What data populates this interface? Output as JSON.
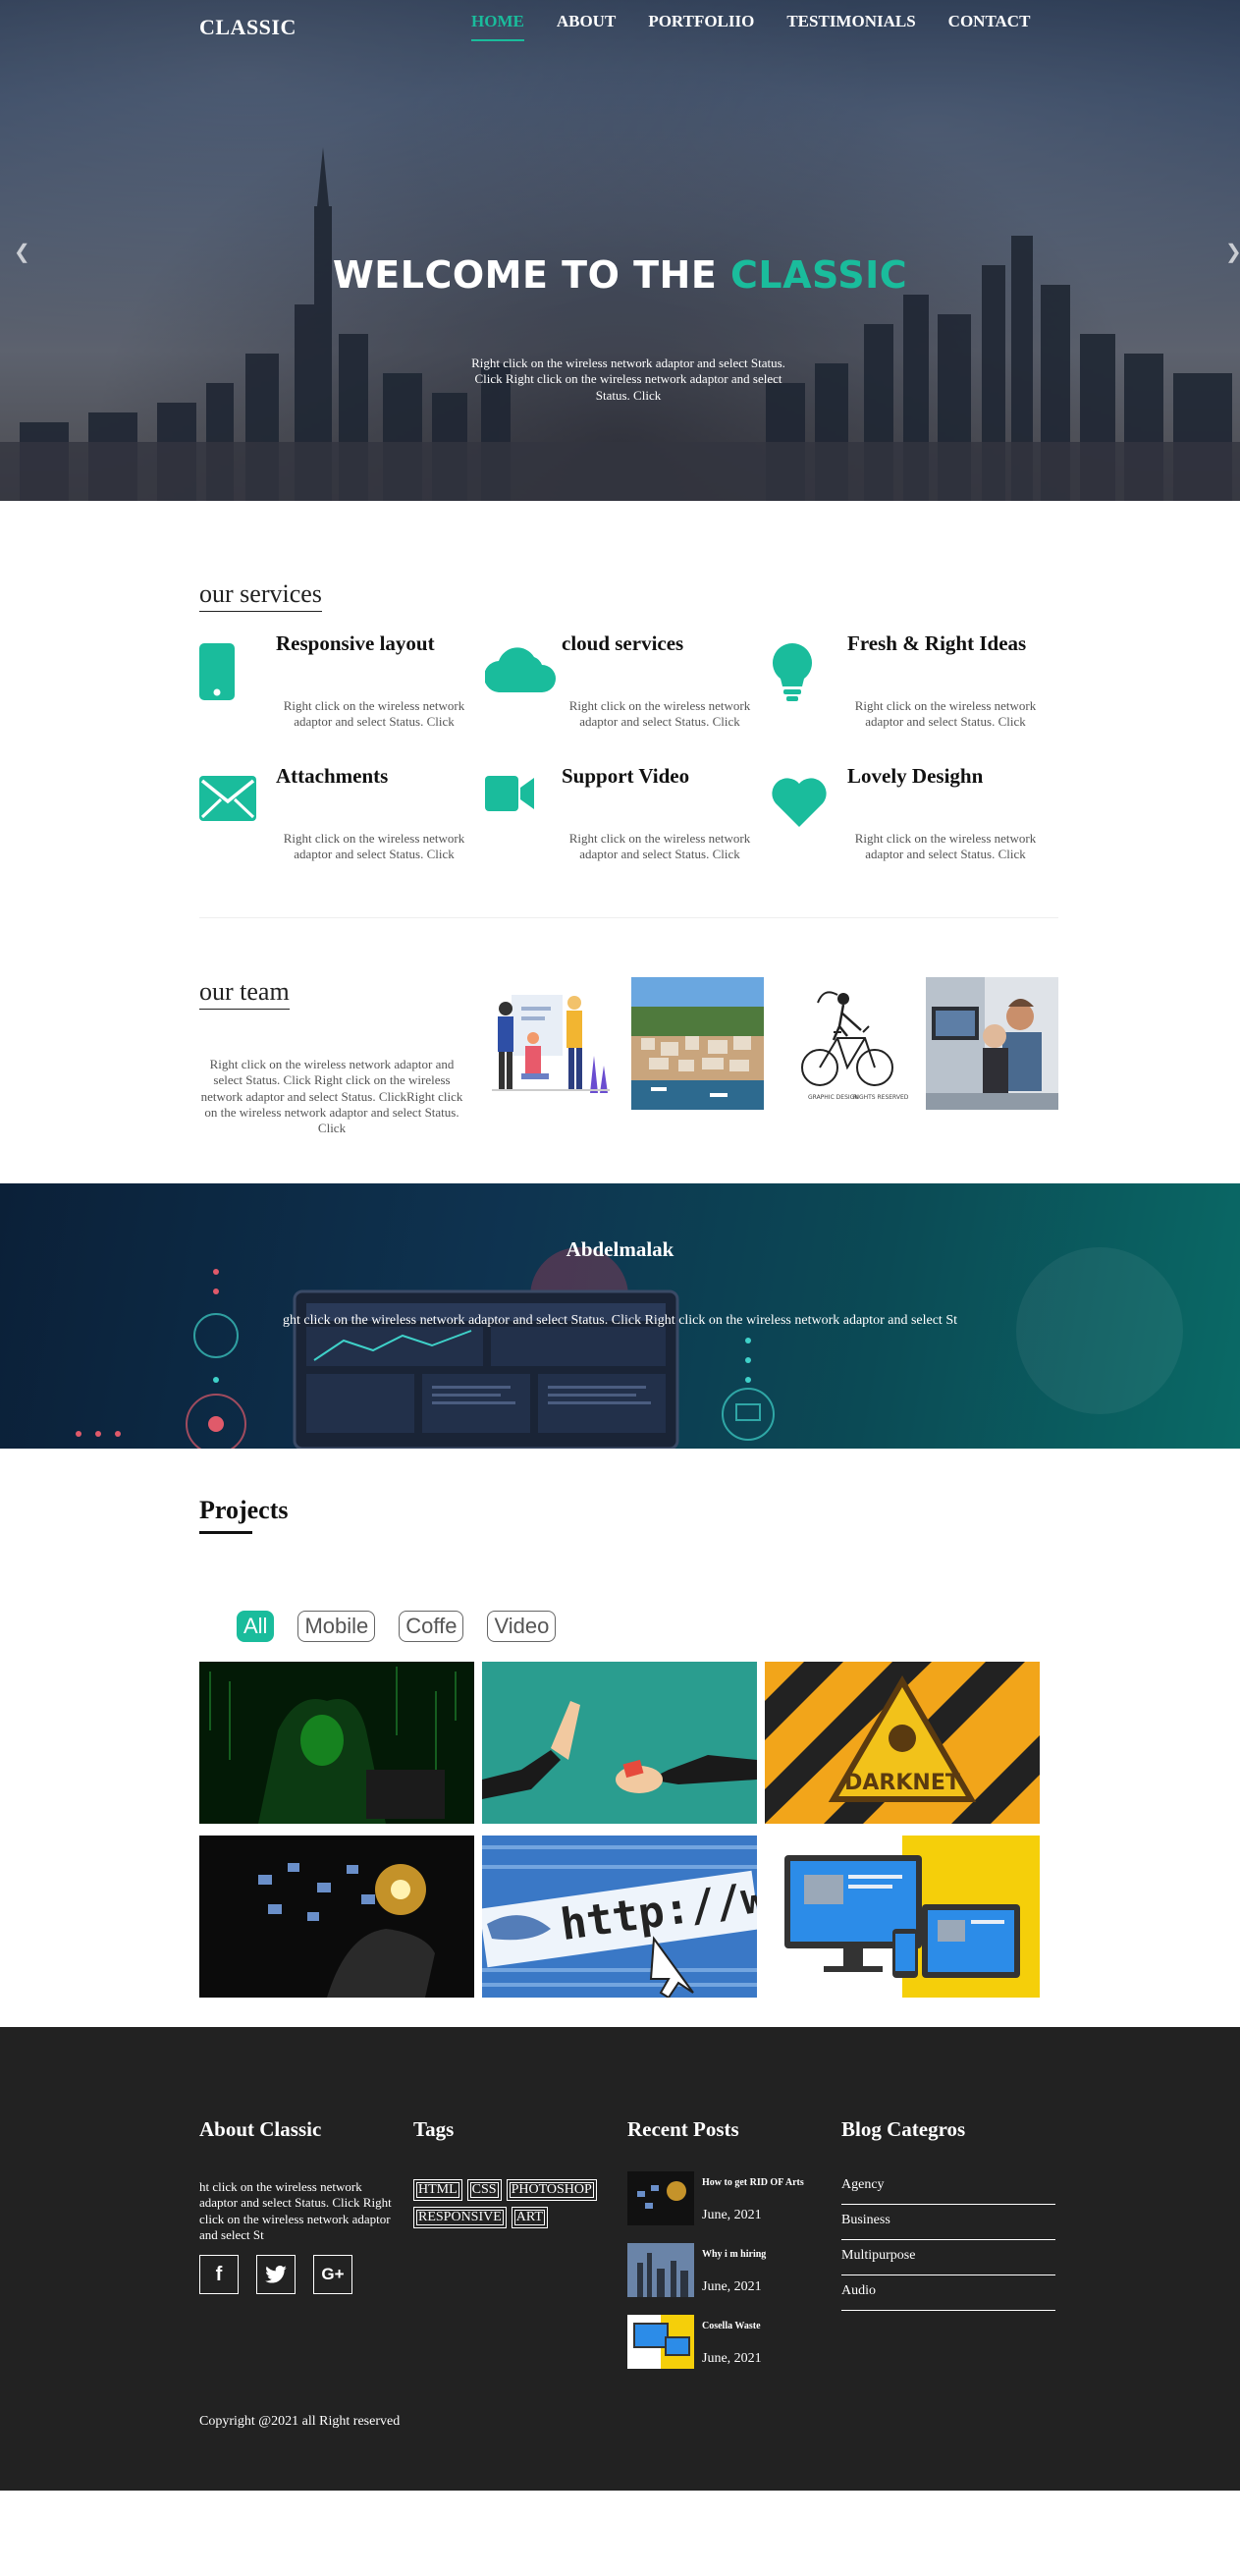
{
  "nav": {
    "logo": "CLASSIC",
    "items": [
      {
        "label": "HOME",
        "active": true
      },
      {
        "label": "ABOUT",
        "active": false
      },
      {
        "label": "PORTFOLIIO",
        "active": false
      },
      {
        "label": "TESTIMONIALS",
        "active": false
      },
      {
        "label": "CONTACT",
        "active": false
      }
    ]
  },
  "hero": {
    "title_main": "WELCOME TO THE ",
    "title_accent": "CLASSIC",
    "text": "Right click on the wireless network adaptor and select Status. Click Right click on the wireless network adaptor and select Status. Click",
    "prev_icon": "chevron-left-icon",
    "next_icon": "chevron-right-icon"
  },
  "services": {
    "title": "our services",
    "items": [
      {
        "title": "Responsive layout",
        "text": "Right click on the wireless network adaptor and select Status. Click",
        "icon": "mobile-icon"
      },
      {
        "title": "cloud services",
        "text": "Right click on the wireless network adaptor and select Status. Click",
        "icon": "cloud-icon"
      },
      {
        "title": "Fresh & Right Ideas",
        "text": "Right click on the wireless network adaptor and select Status. Click",
        "icon": "lightbulb-icon"
      },
      {
        "title": "Attachments",
        "text": "Right click on the wireless network adaptor and select Status. Click",
        "icon": "envelope-icon"
      },
      {
        "title": "Support Video",
        "text": "Right click on the wireless network adaptor and select Status. Click",
        "icon": "video-camera-icon"
      },
      {
        "title": "Lovely Desighn",
        "text": "Right click on the wireless network adaptor and select Status. Click",
        "icon": "heart-icon"
      }
    ]
  },
  "team": {
    "title": "our team",
    "text": "Right click on the wireless network adaptor and select Status. Click Right click on the wireless network adaptor and select Status. ClickRight click on the wireless network adaptor and select Status. Click"
  },
  "banner": {
    "name": "Abdelmalak",
    "text": "ght click on the wireless network adaptor and select Status. Click Right click on the wireless network adaptor and select St"
  },
  "projects": {
    "title": "Projects",
    "filters": [
      {
        "label": "All",
        "active": true
      },
      {
        "label": "Mobile",
        "active": false
      },
      {
        "label": "Coffe",
        "active": false
      },
      {
        "label": "Video",
        "active": false
      }
    ]
  },
  "footer": {
    "about": {
      "title": "About Classic",
      "text": "ht click on the wireless network adaptor and select Status. Click Right click on the wireless network adaptor and select St"
    },
    "socials": [
      "f",
      "🐦",
      "G+"
    ],
    "tags": {
      "title": "Tags",
      "items": [
        "HTML",
        "CSS",
        "PHOTOSHOP",
        "RESPONSIVE",
        "ART"
      ]
    },
    "posts": {
      "title": "Recent Posts",
      "items": [
        {
          "title": "How to get RID OF Arts",
          "date": "June, 2021"
        },
        {
          "title": "Why i m hiring",
          "date": "June, 2021"
        },
        {
          "title": "Cosella Waste",
          "date": "June, 2021"
        }
      ]
    },
    "categories": {
      "title": "Blog Categros",
      "items": [
        "Agency",
        "Business",
        "Multipurpose",
        "Audio"
      ]
    },
    "copyright": "Copyright @2021 all Right reserved"
  },
  "colors": {
    "accent": "#1abc9c",
    "footer_bg": "#222222"
  }
}
